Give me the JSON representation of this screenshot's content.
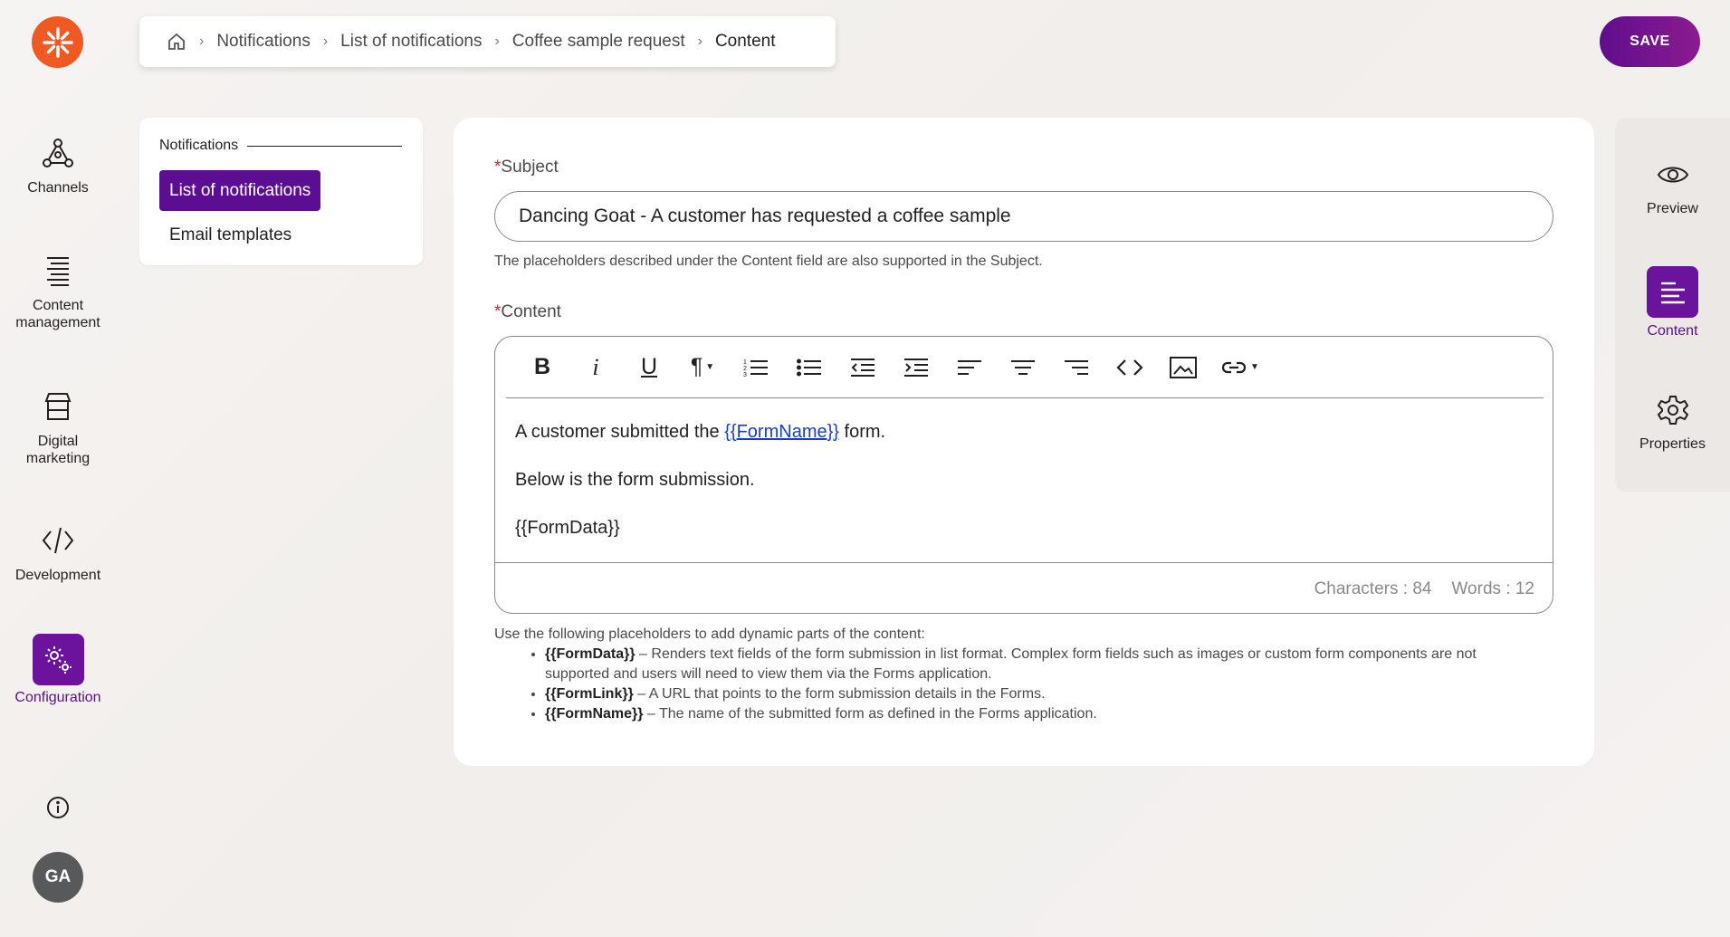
{
  "app": {
    "logo_icon": "kentico-logo-icon",
    "accent_color": "#5b0e91",
    "brand_color": "#f05a22"
  },
  "left_nav": {
    "items": [
      {
        "label": "Channels",
        "icon": "channels-icon"
      },
      {
        "label": "Content management",
        "icon": "content-management-icon"
      },
      {
        "label": "Digital marketing",
        "icon": "digital-marketing-icon"
      },
      {
        "label": "Development",
        "icon": "code-icon"
      },
      {
        "label": "Configuration",
        "icon": "configuration-icon",
        "active": true
      }
    ],
    "info_icon": "info-icon",
    "avatar_initials": "GA"
  },
  "breadcrumb": {
    "home_icon": "home-icon",
    "items": [
      "Notifications",
      "List of notifications",
      "Coffee sample request",
      "Content"
    ]
  },
  "save_label": "SAVE",
  "submenu": {
    "heading": "Notifications",
    "items": [
      {
        "label": "List of notifications",
        "active": true
      },
      {
        "label": "Email templates"
      }
    ]
  },
  "form": {
    "subject": {
      "required_mark": "*",
      "label": "Subject",
      "value": "Dancing Goat - A customer has requested a coffee sample",
      "hint": "The placeholders described under the Content field are also supported in the Subject."
    },
    "content": {
      "required_mark": "*",
      "label": "Content",
      "toolbar": [
        "bold-icon",
        "italic-icon",
        "underline-icon",
        "paragraph-format-icon",
        "ordered-list-icon",
        "unordered-list-icon",
        "outdent-icon",
        "indent-icon",
        "align-left-icon",
        "align-center-icon",
        "align-right-icon",
        "code-view-icon",
        "insert-image-icon",
        "insert-link-icon"
      ],
      "line1_before": "A customer submitted the ",
      "line1_token": "{{FormName}}",
      "line1_after": " form.",
      "line2": "Below is the form submission.",
      "line3": "{{FormData}}",
      "characters_text": "Characters : 84",
      "words_text": "Words : 12"
    },
    "help": {
      "intro": "Use the following placeholders to add dynamic parts of the content:",
      "items": [
        {
          "token": "{{FormData}}",
          "text": " – Renders text fields of the form submission in list format. Complex form fields such as images or custom form components are not supported and users will need to view them via the Forms application."
        },
        {
          "token": "{{FormLink}}",
          "text": " – A URL that points to the form submission details in the Forms."
        },
        {
          "token": "{{FormName}}",
          "text": " – The name of the submitted form as defined in the Forms application."
        }
      ]
    }
  },
  "right_rail": {
    "items": [
      {
        "label": "Preview",
        "icon": "eye-icon"
      },
      {
        "label": "Content",
        "icon": "content-icon",
        "active": true
      },
      {
        "label": "Properties",
        "icon": "gear-icon"
      }
    ]
  }
}
